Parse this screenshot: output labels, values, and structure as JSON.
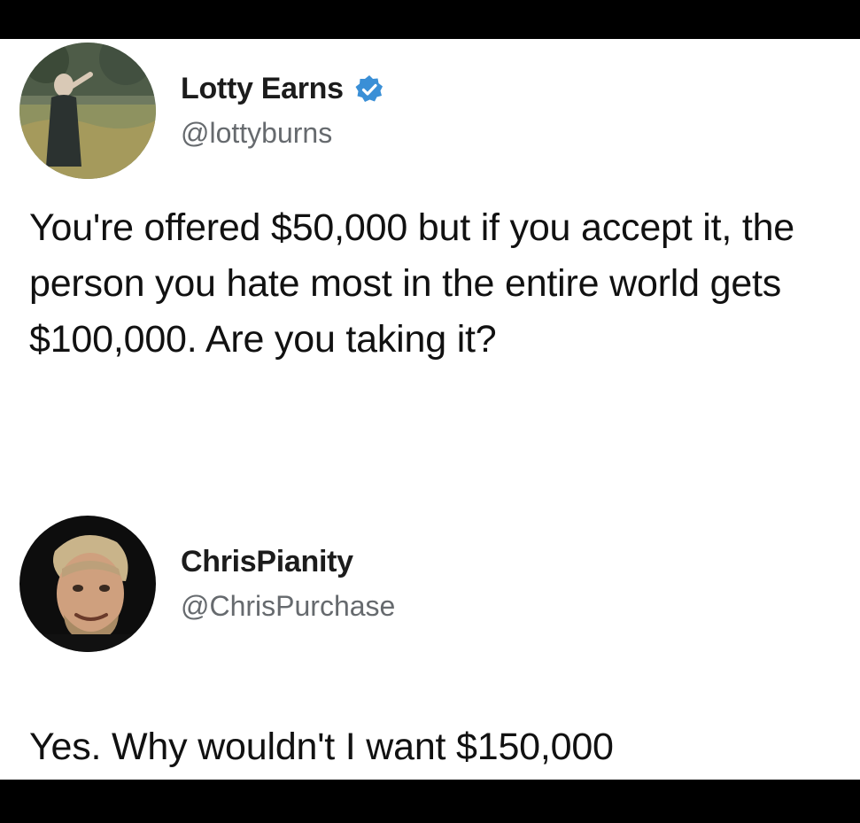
{
  "tweets": [
    {
      "display_name": "Lotty Earns",
      "handle": "@lottyburns",
      "verified": true,
      "verified_icon": "verified-badge-icon",
      "text": "You're offered $50,000 but if you accept it, the person you hate most in the entire world gets $100,000. Are you taking it?"
    },
    {
      "display_name": "ChrisPianity",
      "handle": "@ChrisPurchase",
      "verified": false,
      "text": "Yes. Why wouldn't I want $150,000"
    }
  ],
  "colors": {
    "background": "#ffffff",
    "frame": "#000000",
    "handle": "#666a6e",
    "verified": "#3a8fd6"
  }
}
